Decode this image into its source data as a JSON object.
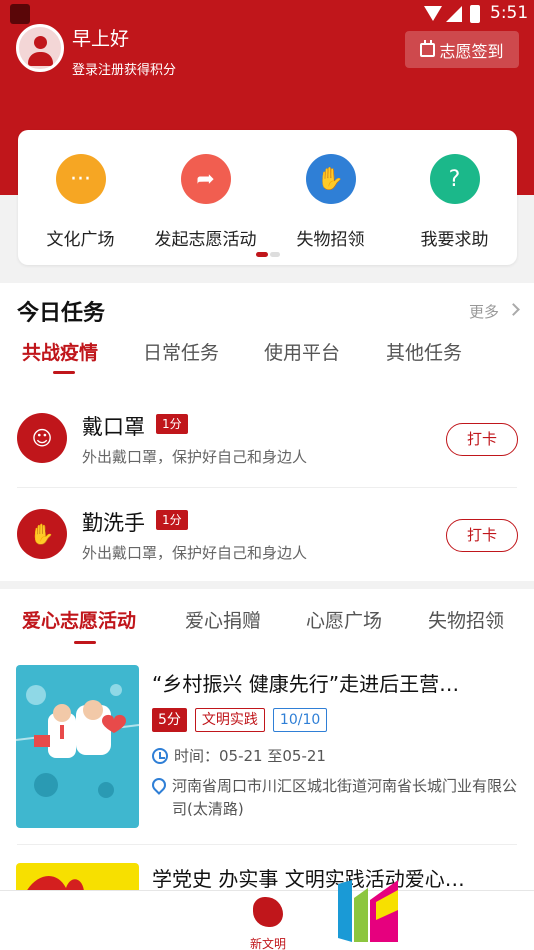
{
  "status_bar": {
    "time": "5:51"
  },
  "header": {
    "greeting": "早上好",
    "login_hint": "登录注册获得积分",
    "checkin_label": "志愿签到",
    "brand_color": "#c0161b"
  },
  "quick_actions": [
    {
      "label": "文化广场",
      "icon": "chat-bubble-icon",
      "color": "#f6a623"
    },
    {
      "label": "发起志愿活动",
      "icon": "share-arrow-icon",
      "color": "#f15e50"
    },
    {
      "label": "失物招领",
      "icon": "lost-found-icon",
      "color": "#2f7fd6"
    },
    {
      "label": "我要求助",
      "icon": "help-message-icon",
      "color": "#1bb88a"
    }
  ],
  "tasks": {
    "title": "今日任务",
    "more_label": "更多",
    "tabs": [
      "共战疫情",
      "日常任务",
      "使用平台",
      "其他任务"
    ],
    "active_tab": 0,
    "items": [
      {
        "name": "戴口罩",
        "points": "1分",
        "desc": "外出戴口罩，保护好自己和身边人",
        "action": "打卡",
        "icon": "mask-icon"
      },
      {
        "name": "勤洗手",
        "points": "1分",
        "desc": "外出戴口罩，保护好自己和身边人",
        "action": "打卡",
        "icon": "hand-wash-icon"
      }
    ]
  },
  "activities": {
    "tabs": [
      "爱心志愿活动",
      "爱心捐赠",
      "心愿广场",
      "失物招领"
    ],
    "active_tab": 0,
    "items": [
      {
        "title": "“乡村振兴 健康先行”走进后王营…",
        "score": "5分",
        "type": "文明实践",
        "count": "10/10",
        "time": "时间：05-21 至05-21",
        "address": "河南省周口市川汇区城北街道河南省长城门业有限公司(太清路)"
      },
      {
        "title": "学党史 办实事 文明实践活动爱心…"
      }
    ]
  },
  "bottom_nav": {
    "label": "新文明"
  }
}
